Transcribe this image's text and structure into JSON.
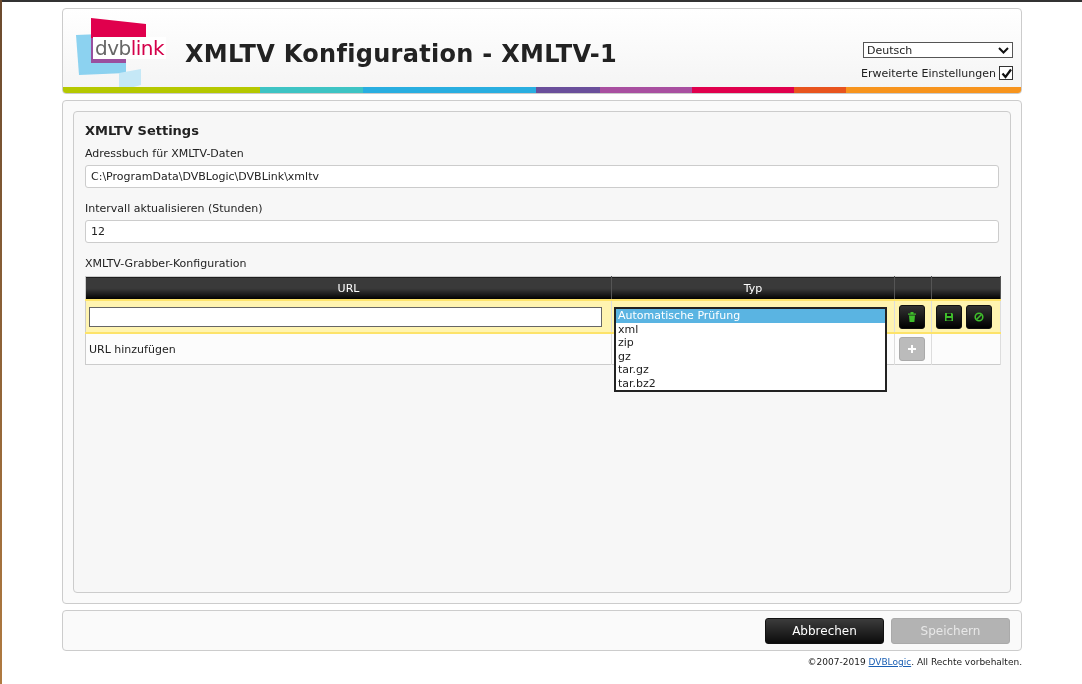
{
  "header": {
    "logo": {
      "part1": "dvb",
      "part2": "link"
    },
    "title": "XMLTV Konfiguration - XMLTV-1",
    "language": "Deutsch",
    "advanced": {
      "label": "Erweiterte Einstellungen",
      "checked": true
    }
  },
  "settings": {
    "title": "XMLTV Settings",
    "fields": [
      {
        "label": "Adressbuch für XMLTV-Daten",
        "value": "C:\\ProgramData\\DVBLogic\\DVBLink\\xmltv"
      },
      {
        "label": "Intervall aktualisieren (Stunden)",
        "value": "12"
      }
    ],
    "grabber": {
      "label": "XMLTV-Grabber-Konfiguration",
      "columns": [
        "URL",
        "Typ"
      ],
      "type_options": [
        {
          "label": "Automatische Prüfung",
          "selected": true
        },
        {
          "label": "xml",
          "selected": false
        },
        {
          "label": "zip",
          "selected": false
        },
        {
          "label": "gz",
          "selected": false
        },
        {
          "label": "tar.gz",
          "selected": false
        },
        {
          "label": "tar.bz2",
          "selected": false
        }
      ],
      "add_row": {
        "label": "URL hinzufügen"
      }
    }
  },
  "buttons": [
    {
      "label": "Abbrechen",
      "disabled": false
    },
    {
      "label": "Speichern",
      "disabled": true
    }
  ],
  "footer": {
    "before": "©2007-2019 ",
    "link": "DVBLogic",
    "after": ". All Rechte vorbehalten."
  }
}
